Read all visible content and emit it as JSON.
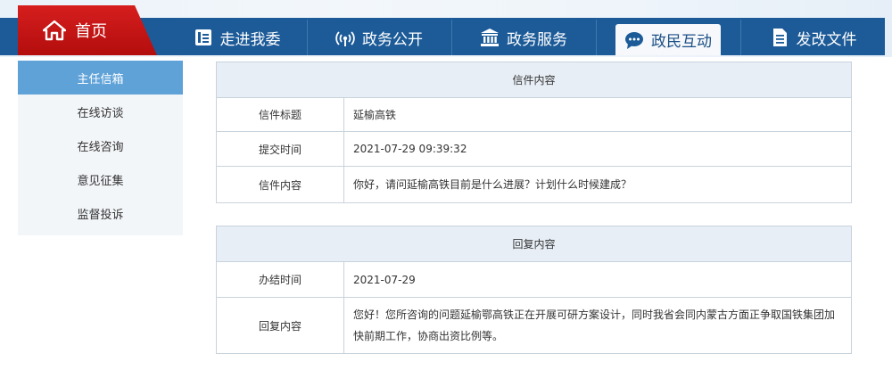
{
  "nav": {
    "home_label": "首页",
    "items": [
      {
        "label": "走进我委",
        "icon": "id-card-icon"
      },
      {
        "label": "政务公开",
        "icon": "broadcast-icon"
      },
      {
        "label": "政务服务",
        "icon": "building-icon"
      },
      {
        "label": "政民互动",
        "icon": "chat-bubble-icon"
      },
      {
        "label": "发改文件",
        "icon": "document-icon"
      }
    ],
    "active_index": 3,
    "colors": {
      "bar": "#1c5b98",
      "home": "#c61414",
      "active_text": "#1c4f86"
    }
  },
  "sidebar": {
    "items": [
      {
        "label": "主任信箱"
      },
      {
        "label": "在线访谈"
      },
      {
        "label": "在线咨询"
      },
      {
        "label": "意见征集"
      },
      {
        "label": "监督投诉"
      }
    ],
    "active_index": 0,
    "colors": {
      "active_bg": "#5ea2d8"
    }
  },
  "letter": {
    "header": "信件内容",
    "title_label": "信件标题",
    "title_value": "延榆高铁",
    "time_label": "提交时间",
    "time_value": "2021-07-29 09:39:32",
    "content_label": "信件内容",
    "content_value": "你好，请问延榆高铁目前是什么进展？计划什么时候建成？"
  },
  "reply": {
    "header": "回复内容",
    "time_label": "办结时间",
    "time_value": "2021-07-29",
    "content_label": "回复内容",
    "content_value": "您好！您所咨询的问题延榆鄂高铁正在开展可研方案设计，同时我省会同内蒙古方面正争取国铁集团加快前期工作，协商出资比例等。"
  }
}
